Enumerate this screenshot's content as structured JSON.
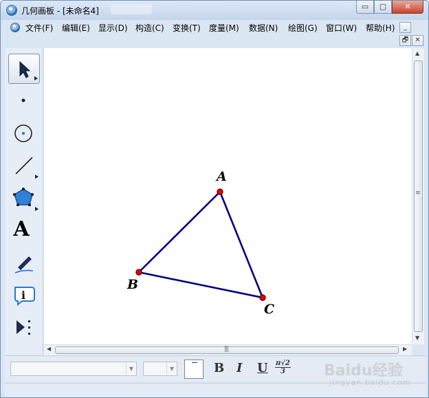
{
  "window": {
    "title": "几何画板 - [未命名4]",
    "controls": {
      "minimize": "▭",
      "maximize": "▢",
      "close": "✕"
    },
    "mdi": {
      "restore": "🗗",
      "close": "✕",
      "minimize": "_"
    }
  },
  "menu": {
    "items": [
      {
        "label": "文件(F)"
      },
      {
        "label": "编辑(E)"
      },
      {
        "label": "显示(D)"
      },
      {
        "label": "构造(C)"
      },
      {
        "label": "变换(T)"
      },
      {
        "label": "度量(M)"
      },
      {
        "label": "数据(N)"
      },
      {
        "label": "绘图(G)"
      },
      {
        "label": "窗口(W)"
      },
      {
        "label": "帮助(H)"
      }
    ]
  },
  "toolbox": {
    "tools": [
      {
        "name": "arrow-select-tool",
        "icon": "arrow-icon",
        "active": true
      },
      {
        "name": "point-tool",
        "icon": "point-icon"
      },
      {
        "name": "compass-tool",
        "icon": "circle-icon"
      },
      {
        "name": "straightedge-tool",
        "icon": "segment-icon"
      },
      {
        "name": "polygon-tool",
        "icon": "polygon-icon"
      },
      {
        "name": "text-tool",
        "icon": "text-icon",
        "label": "A"
      },
      {
        "name": "marker-tool",
        "icon": "marker-icon"
      },
      {
        "name": "info-tool",
        "icon": "info-icon"
      },
      {
        "name": "custom-tool",
        "icon": "custom-tool-icon"
      }
    ]
  },
  "canvas": {
    "line_color": "#000080",
    "point_color": "#e00000",
    "points": [
      {
        "label": "A"
      },
      {
        "label": "B"
      },
      {
        "label": "C"
      }
    ],
    "segments": [
      [
        "A",
        "B"
      ],
      [
        "A",
        "C"
      ],
      [
        "B",
        "C"
      ]
    ]
  },
  "formatbar": {
    "bold_label": "B",
    "italic_label": "I",
    "underline_label": "U",
    "math_num": "π√2",
    "math_den": "3"
  },
  "watermark": {
    "text": "Baidu经验",
    "sub": "jingyan.baidu.com"
  }
}
